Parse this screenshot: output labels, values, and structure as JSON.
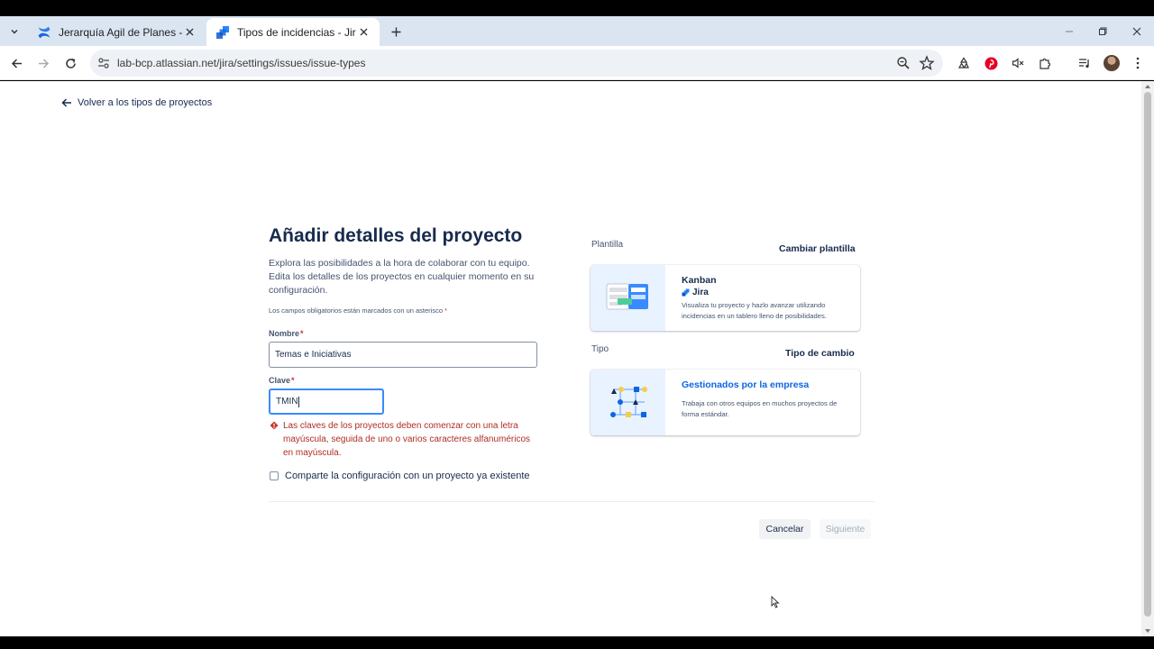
{
  "browser": {
    "tabs": [
      {
        "title": "Jerarquía Agil de Planes - Ivan Fer",
        "active": false,
        "icon": "confluence-icon"
      },
      {
        "title": "Tipos de incidencias - Jira",
        "active": true,
        "icon": "jira-icon"
      }
    ],
    "url": "lab-bcp.atlassian.net/jira/settings/issues/issue-types"
  },
  "page": {
    "back_link": "Volver a los tipos de proyectos",
    "heading": "Añadir detalles del proyecto",
    "description": "Explora las posibilidades a la hora de colaborar con tu equipo. Edita los detalles de los proyectos en cualquier momento en su configuración.",
    "required_note": "Los campos obligatorios están marcados con un asterisco",
    "required_marker": "*",
    "name_field": {
      "label": "Nombre",
      "value": "Temas e Iniciativas"
    },
    "key_field": {
      "label": "Clave",
      "value": "TMIN"
    },
    "key_error": "Las claves de los proyectos deben comenzar con una letra mayúscula, seguida de uno o varios caracteres alfanuméricos en mayúscula.",
    "share_config_label": "Comparte la configuración con un proyecto ya existente",
    "template": {
      "section_label": "Plantilla",
      "change_action": "Cambiar plantilla",
      "title": "Kanban",
      "product": "Jira",
      "description": "Visualiza tu proyecto y hazlo avanzar utilizando incidencias en un tablero lleno de posibilidades."
    },
    "type": {
      "section_label": "Tipo",
      "change_action": "Tipo de cambio",
      "title": "Gestionados por la empresa",
      "description": "Trabaja con otros equipos en muchos proyectos de forma estándar."
    },
    "cancel_label": "Cancelar",
    "next_label": "Siguiente"
  },
  "colors": {
    "brand_blue": "#0c66e4",
    "error_red": "#ae2e24",
    "focus_blue": "#388bff"
  }
}
